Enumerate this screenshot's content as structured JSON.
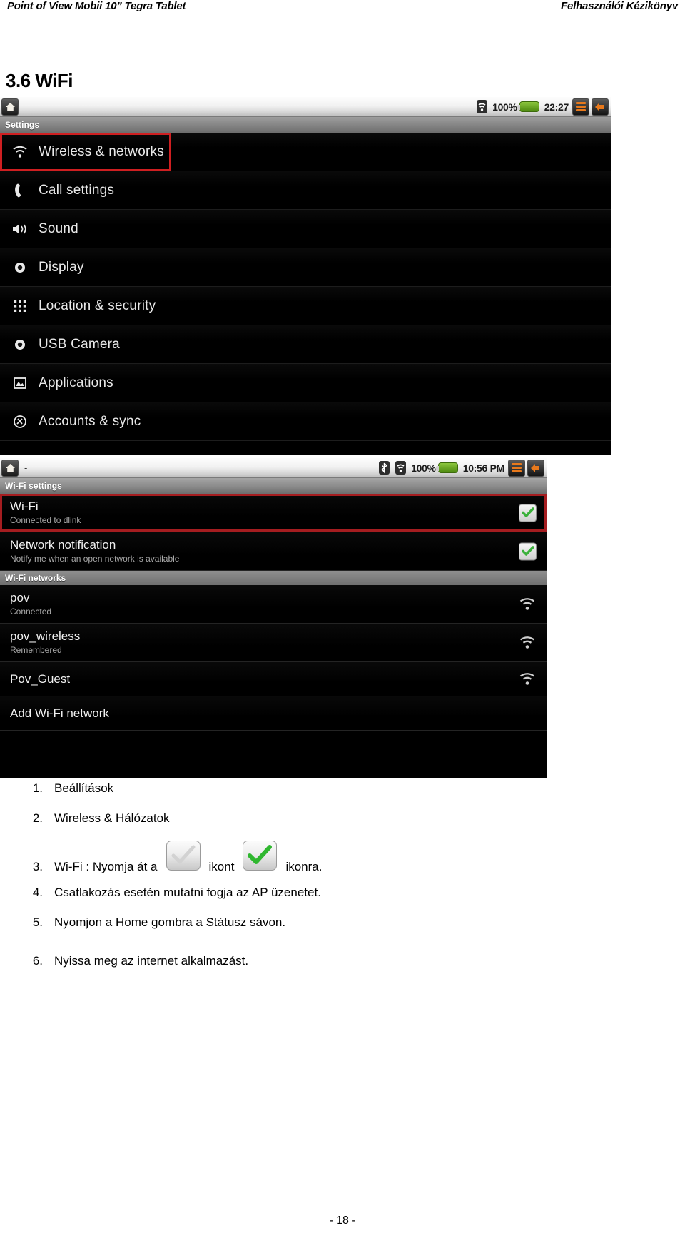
{
  "running_head": {
    "left": "Point of View Mobii 10” Tegra Tablet",
    "right": "Felhasználói Kézikönyv"
  },
  "section": {
    "title": "3.6 WiFi"
  },
  "screenshot_settings": {
    "status_bar": {
      "home_icon": "home-icon",
      "wifi_icon": "wifi-signal-icon",
      "battery_percent": "100%",
      "battery_icon": "battery-full-icon",
      "time": "22:27",
      "menu_icon": "menu-icon",
      "back_icon": "back-arrow-icon"
    },
    "title_bar": "Settings",
    "highlight_color": "#cf1f21",
    "items": [
      {
        "label": "Wireless & networks",
        "icon": "wifi-icon",
        "highlighted": true
      },
      {
        "label": "Call settings",
        "icon": "phone-icon",
        "highlighted": false
      },
      {
        "label": "Sound",
        "icon": "speaker-icon",
        "highlighted": false
      },
      {
        "label": "Display",
        "icon": "brightness-icon",
        "highlighted": false
      },
      {
        "label": "Location & security",
        "icon": "grid-dots-icon",
        "highlighted": false
      },
      {
        "label": "USB Camera",
        "icon": "brightness-icon",
        "highlighted": false
      },
      {
        "label": "Applications",
        "icon": "applications-icon",
        "highlighted": false
      },
      {
        "label": "Accounts & sync",
        "icon": "sync-icon",
        "highlighted": false
      }
    ]
  },
  "screenshot_wifi": {
    "status_bar": {
      "home_icon": "home-icon",
      "dash": "-",
      "bluetooth_icon": "bluetooth-icon",
      "wifi_icon": "wifi-signal-icon",
      "battery_percent": "100%",
      "battery_icon": "battery-full-icon",
      "time": "10:56 PM",
      "menu_icon": "menu-icon",
      "back_icon": "back-arrow-icon"
    },
    "title_bar": "Wi-Fi settings",
    "highlight_color": "#a51d20",
    "toggles": [
      {
        "title": "Wi-Fi",
        "subtitle": "Connected to dlink",
        "checked": true,
        "highlighted": true
      },
      {
        "title": "Network notification",
        "subtitle": "Notify me when an open network is available",
        "checked": true,
        "highlighted": false
      }
    ],
    "networks_header": "Wi-Fi networks",
    "networks": [
      {
        "ssid": "pov",
        "status": "Connected",
        "signal_icon": "wifi-signal-icon"
      },
      {
        "ssid": "pov_wireless",
        "status": "Remembered",
        "signal_icon": "wifi-signal-icon"
      },
      {
        "ssid": "Pov_Guest",
        "status": "",
        "signal_icon": "wifi-signal-icon"
      }
    ],
    "add_network": "Add Wi-Fi network"
  },
  "steps": [
    {
      "num": "1.",
      "text": "Beállítások"
    },
    {
      "num": "2.",
      "text": "Wireless & Hálózatok"
    },
    {
      "num": "3.",
      "text_before": "Wi-Fi :  Nyomja át a",
      "text_middle": "ikont",
      "text_after": "ikonra.",
      "icon_unchecked": "checkbox-unchecked-icon",
      "icon_checked": "checkbox-checked-icon"
    },
    {
      "num": "4.",
      "text": "Csatlakozás esetén mutatni fogja az AP üzenetet."
    },
    {
      "num": "5.",
      "text": "Nyomjon a Home gombra a Státusz sávon."
    },
    {
      "num": "6.",
      "text": "Nyissa meg az internet alkalmazást."
    }
  ],
  "page_number": "- 18 -"
}
